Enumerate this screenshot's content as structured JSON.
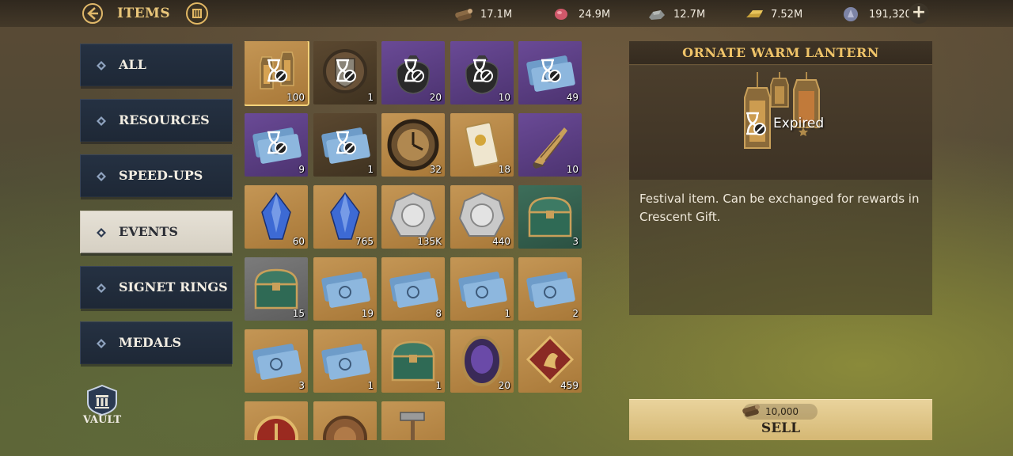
{
  "header": {
    "title": "ITEMS",
    "resources": [
      {
        "name": "wood",
        "icon": "wood-log-icon",
        "value": "17.1M"
      },
      {
        "name": "food",
        "icon": "meat-icon",
        "value": "24.9M"
      },
      {
        "name": "stone",
        "icon": "stone-icon",
        "value": "12.7M"
      },
      {
        "name": "gold",
        "icon": "gold-bar-icon",
        "value": "7.52M"
      },
      {
        "name": "gems",
        "icon": "gem-icon",
        "value": "191,320"
      }
    ]
  },
  "tabs": [
    {
      "label": "ALL",
      "active": false
    },
    {
      "label": "RESOURCES",
      "active": false
    },
    {
      "label": "SPEED-UPS",
      "active": false
    },
    {
      "label": "EVENTS",
      "active": true
    },
    {
      "label": "SIGNET RINGS",
      "active": false
    },
    {
      "label": "MEDALS",
      "active": false
    }
  ],
  "vault_label": "VAULT",
  "items": [
    {
      "name": "ornate-warm-lantern",
      "bg": "gold",
      "qty": "100",
      "expired": true,
      "selected": true,
      "icon": "lantern-icon"
    },
    {
      "name": "crest-frame",
      "bg": "brown",
      "qty": "1",
      "expired": true,
      "icon": "crest-icon"
    },
    {
      "name": "lantern-bag",
      "bg": "purple",
      "qty": "20",
      "expired": true,
      "icon": "bag-icon"
    },
    {
      "name": "lantern-bag-2",
      "bg": "purple",
      "qty": "10",
      "expired": true,
      "icon": "bag-icon"
    },
    {
      "name": "blue-ticket",
      "bg": "purple",
      "qty": "49",
      "expired": true,
      "icon": "ticket-icon"
    },
    {
      "name": "blue-ticket-2",
      "bg": "purple",
      "qty": "9",
      "expired": true,
      "icon": "ticket-icon"
    },
    {
      "name": "green-ticket",
      "bg": "brown",
      "qty": "1",
      "expired": true,
      "icon": "ticket-icon"
    },
    {
      "name": "clock-medallion",
      "bg": "gold",
      "qty": "32",
      "icon": "clock-icon"
    },
    {
      "name": "gold-card",
      "bg": "gold",
      "qty": "18",
      "icon": "card-icon"
    },
    {
      "name": "horn",
      "bg": "purple",
      "qty": "10",
      "icon": "horn-icon"
    },
    {
      "name": "blue-crystal",
      "bg": "gold",
      "qty": "60",
      "icon": "crystal-icon"
    },
    {
      "name": "red-crystal",
      "bg": "gold",
      "qty": "765",
      "icon": "crystal-icon"
    },
    {
      "name": "silver-coin",
      "bg": "gold",
      "qty": "135K",
      "icon": "coin-icon"
    },
    {
      "name": "gold-coin",
      "bg": "gold",
      "qty": "440",
      "icon": "coin-icon"
    },
    {
      "name": "green-chest",
      "bg": "green",
      "qty": "3",
      "icon": "chest-icon"
    },
    {
      "name": "black-chest",
      "bg": "grey",
      "qty": "15",
      "icon": "chest-icon"
    },
    {
      "name": "blue-ticket-3",
      "bg": "gold",
      "qty": "19",
      "icon": "ticket-icon"
    },
    {
      "name": "blue-ticket-4",
      "bg": "gold",
      "qty": "8",
      "icon": "ticket-icon"
    },
    {
      "name": "blue-ticket-5",
      "bg": "gold",
      "qty": "1",
      "icon": "ticket-icon"
    },
    {
      "name": "green-ticket-2",
      "bg": "gold",
      "qty": "2",
      "icon": "ticket-icon"
    },
    {
      "name": "green-ticket-3",
      "bg": "gold",
      "qty": "3",
      "icon": "ticket-icon"
    },
    {
      "name": "green-ticket-4",
      "bg": "gold",
      "qty": "1",
      "icon": "ticket-icon"
    },
    {
      "name": "red-chest",
      "bg": "gold",
      "qty": "1",
      "icon": "chest-icon"
    },
    {
      "name": "purple-amulet",
      "bg": "gold",
      "qty": "20",
      "icon": "amulet-icon"
    },
    {
      "name": "red-badge",
      "bg": "gold",
      "qty": "459",
      "icon": "badge-icon"
    },
    {
      "name": "red-token",
      "bg": "gold",
      "qty": "",
      "icon": "token-icon"
    },
    {
      "name": "bronze-medal",
      "bg": "gold",
      "qty": "",
      "icon": "medal-icon"
    },
    {
      "name": "hammer",
      "bg": "gold",
      "qty": "",
      "icon": "hammer-icon"
    }
  ],
  "detail": {
    "title": "ORNATE WARM LANTERN",
    "status": "Expired",
    "description": "Festival item. Can be exchanged for rewards in Crescent Gift."
  },
  "sell": {
    "price": "10,000",
    "label": "SELL"
  },
  "colors": {
    "accent_gold": "#f0c469",
    "tab_bg": "#253142",
    "tab_active_bg": "#e6e1d6"
  }
}
